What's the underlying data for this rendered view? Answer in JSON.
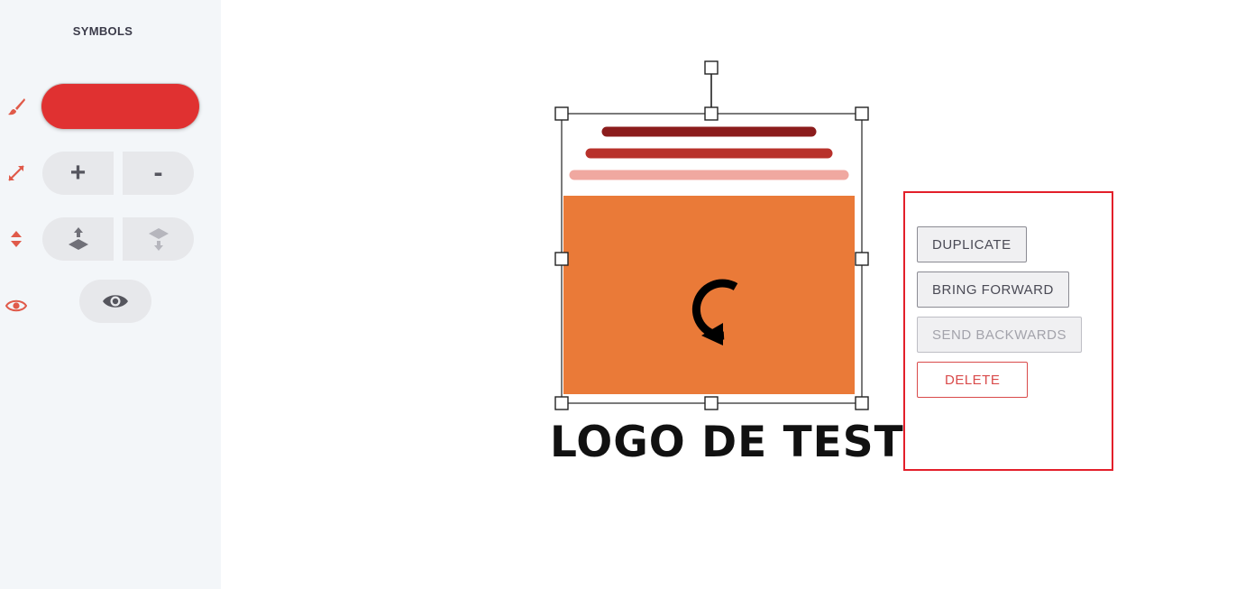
{
  "sidebar": {
    "title": "SYMBOLS",
    "color_value": "#e03131",
    "accent_color": "#e05a4a",
    "icons": {
      "color": "paintbrush-icon",
      "size": "resize-arrows-icon",
      "layer": "layer-order-icon",
      "visibility": "eye-icon"
    },
    "size_controls": {
      "increase_label": "+",
      "decrease_label": "-"
    },
    "layer_controls": {
      "up_icon": "layer-up-icon",
      "down_icon": "layer-down-icon"
    },
    "visibility_toggle": {
      "icon": "eye-icon"
    }
  },
  "canvas": {
    "logo_text": "LOGO DE TESTE",
    "symbol_colors": {
      "line_dark": "#8b1c1c",
      "line_mid": "#b8312b",
      "line_light": "#f0a8a0",
      "block": "#ea7a38"
    },
    "rotate_icon": "rotate-icon"
  },
  "context_menu": {
    "duplicate_label": "DUPLICATE",
    "bring_forward_label": "BRING FORWARD",
    "send_backwards_label": "SEND BACKWARDS",
    "delete_label": "DELETE"
  }
}
